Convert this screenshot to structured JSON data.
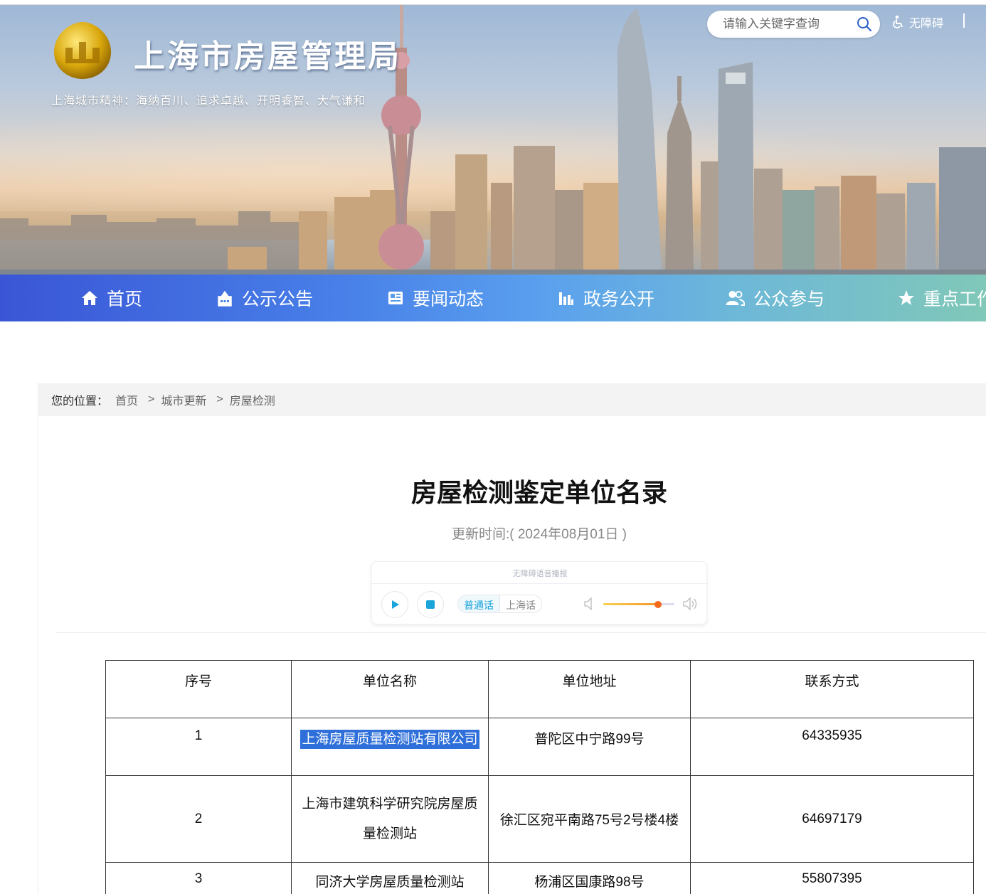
{
  "header": {
    "site_title": "上海市房屋管理局",
    "slogan": "上海城市精神：海纳百川、追求卓越、开明睿智、大气谦和",
    "search_placeholder": "请输入关键字查询",
    "accessibility_label": "无障碍"
  },
  "nav": {
    "items": [
      {
        "label": "首页",
        "icon": "home-icon"
      },
      {
        "label": "公示公告",
        "icon": "notice-icon"
      },
      {
        "label": "要闻动态",
        "icon": "news-icon"
      },
      {
        "label": "政务公开",
        "icon": "chart-icon"
      },
      {
        "label": "公众参与",
        "icon": "users-icon"
      },
      {
        "label": "重点工作",
        "icon": "star-icon"
      }
    ]
  },
  "breadcrumb": {
    "prefix": "您的位置：",
    "items": [
      "首页",
      "城市更新",
      "房屋检测"
    ],
    "separator": ">"
  },
  "article": {
    "title": "房屋检测鉴定单位名录",
    "date": "更新时间:( 2024年08月01日 )"
  },
  "player": {
    "label": "无障碍语音播报",
    "lang_active": "普通话",
    "lang_other": "上海话",
    "volume": 0.75
  },
  "table": {
    "headers": [
      "序号",
      "单位名称",
      "单位地址",
      "联系方式"
    ],
    "rows": [
      {
        "no": "1",
        "name": "上海房屋质量检测站有限公司",
        "address": "普陀区中宁路99号",
        "phone": "64335935"
      },
      {
        "no": "2",
        "name": "上海市建筑科学研究院房屋质量检测站",
        "address": "徐汇区宛平南路75号2号楼4楼",
        "phone": "64697179"
      },
      {
        "no": "3",
        "name": "同济大学房屋质量检测站",
        "address": "杨浦区国康路98号",
        "phone": "55807395"
      }
    ]
  },
  "colors": {
    "nav_start": "#3a56d6",
    "nav_end": "#80c8b8",
    "selection": "#2e6fd9",
    "player_accent": "#1aa4d8"
  }
}
